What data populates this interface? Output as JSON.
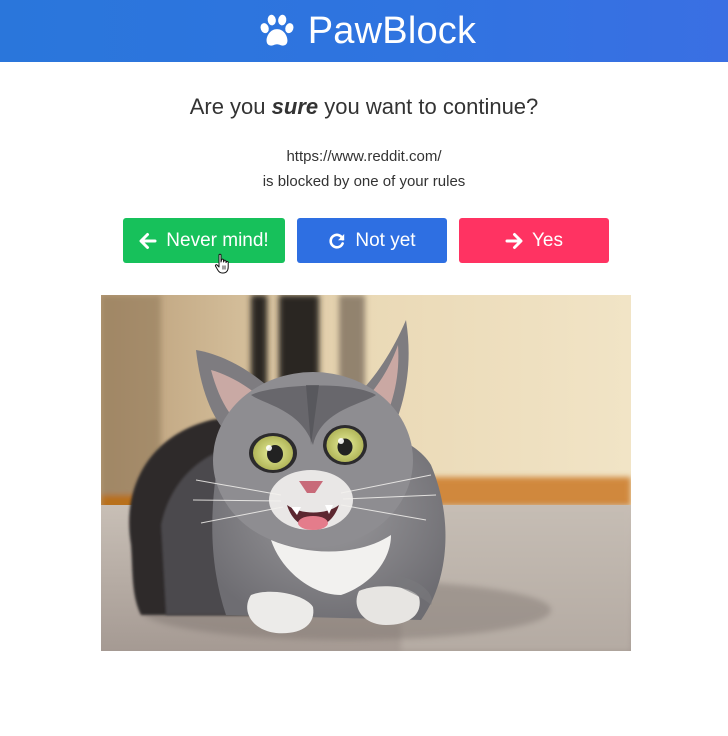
{
  "header": {
    "brand_name": "PawBlock",
    "logo_icon": "paw-icon"
  },
  "prompt": {
    "question_before": "Are you ",
    "question_emphasis": "sure",
    "question_after": " you want to continue?",
    "url": "https://www.reddit.com/",
    "message": "is blocked by one of your rules"
  },
  "buttons": {
    "never_mind": {
      "label": "Never mind!",
      "icon": "arrow-left-icon",
      "color": "#17c15b"
    },
    "not_yet": {
      "label": "Not yet",
      "icon": "rotate-icon",
      "color": "#2e6fe2"
    },
    "yes": {
      "label": "Yes",
      "icon": "arrow-right-icon",
      "color": "#ff3362"
    }
  },
  "image": {
    "subject": "cat-photo"
  },
  "colors": {
    "header_gradient_start": "#2a76db",
    "header_gradient_end": "#3a6fe3"
  }
}
